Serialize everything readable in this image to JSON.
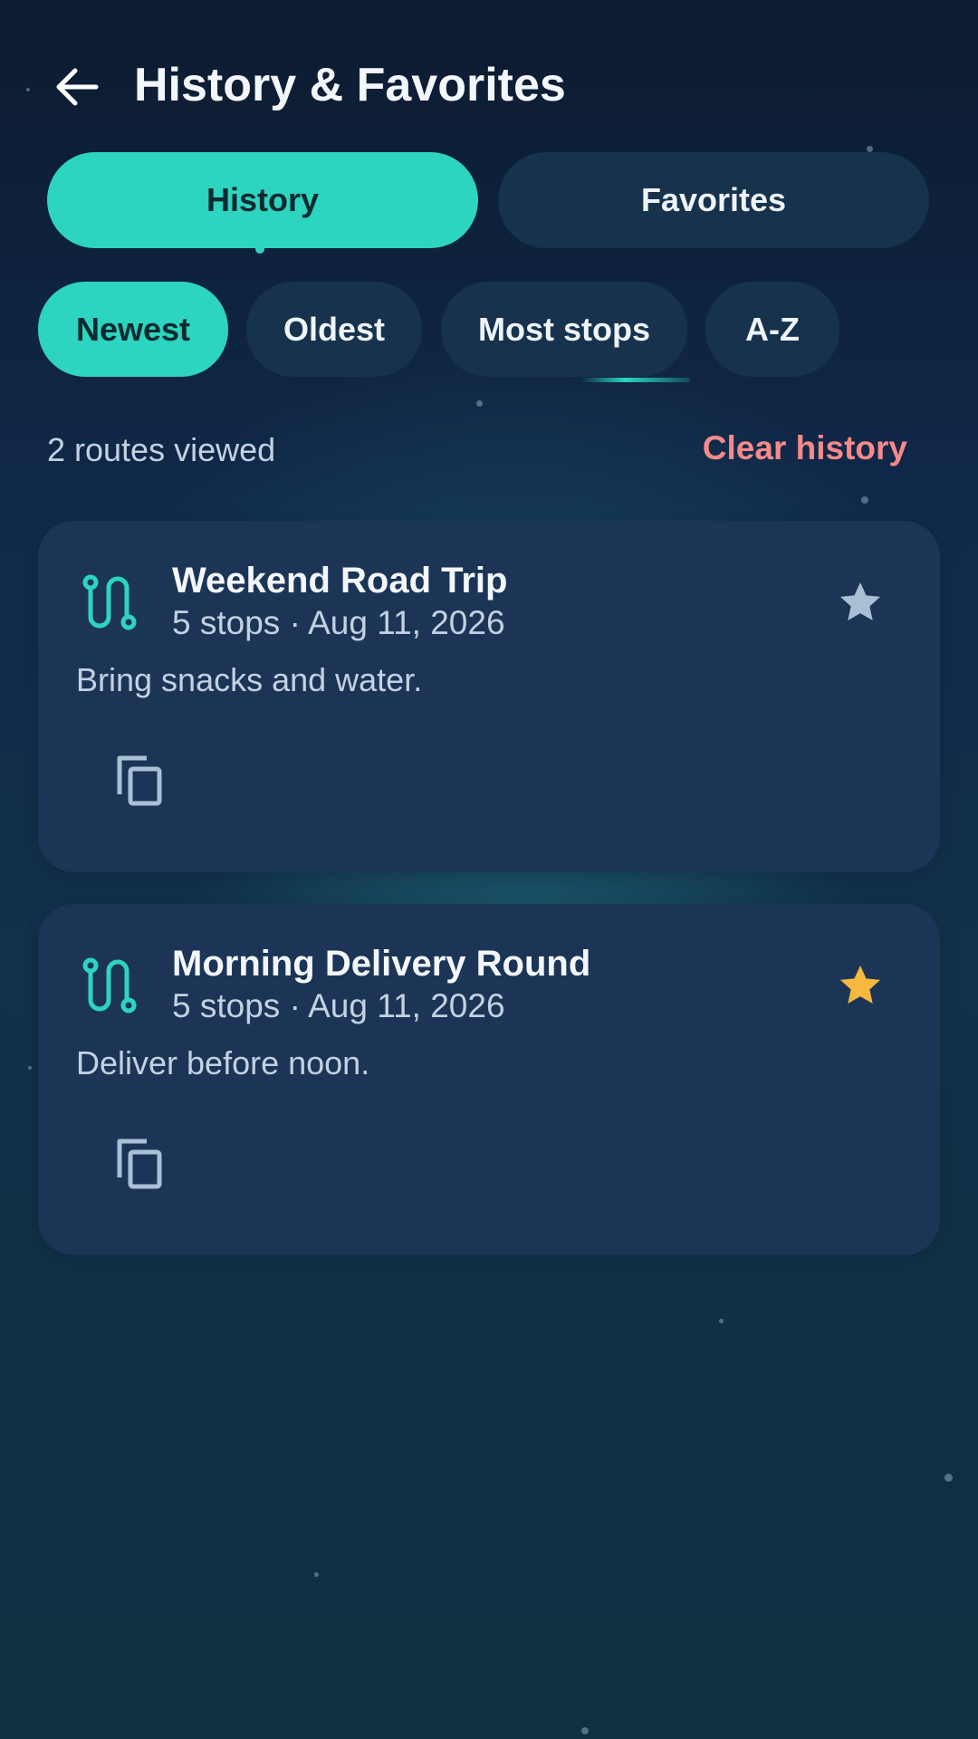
{
  "header": {
    "title": "History & Favorites",
    "back_icon": "arrow-left-icon"
  },
  "tabs": [
    {
      "label": "History",
      "active": true
    },
    {
      "label": "Favorites",
      "active": false
    }
  ],
  "sort_chips": [
    {
      "label": "Newest",
      "active": true
    },
    {
      "label": "Oldest",
      "active": false
    },
    {
      "label": "Most stops",
      "active": false
    },
    {
      "label": "A-Z",
      "active": false
    }
  ],
  "summary": {
    "count_text": "2 routes viewed",
    "clear_label": "Clear history"
  },
  "routes": [
    {
      "title": "Weekend Road Trip",
      "meta": "5 stops · Aug 11, 2026",
      "note": "Bring snacks and water.",
      "favorite": false
    },
    {
      "title": "Morning Delivery Round",
      "meta": "5 stops · Aug 11, 2026",
      "note": "Deliver before noon.",
      "favorite": true
    }
  ],
  "colors": {
    "accent": "#2dd4bf",
    "danger": "#f58a8a",
    "star_active": "#f6b83f",
    "star_inactive": "#a9bfd3",
    "card": "#1c3556"
  }
}
